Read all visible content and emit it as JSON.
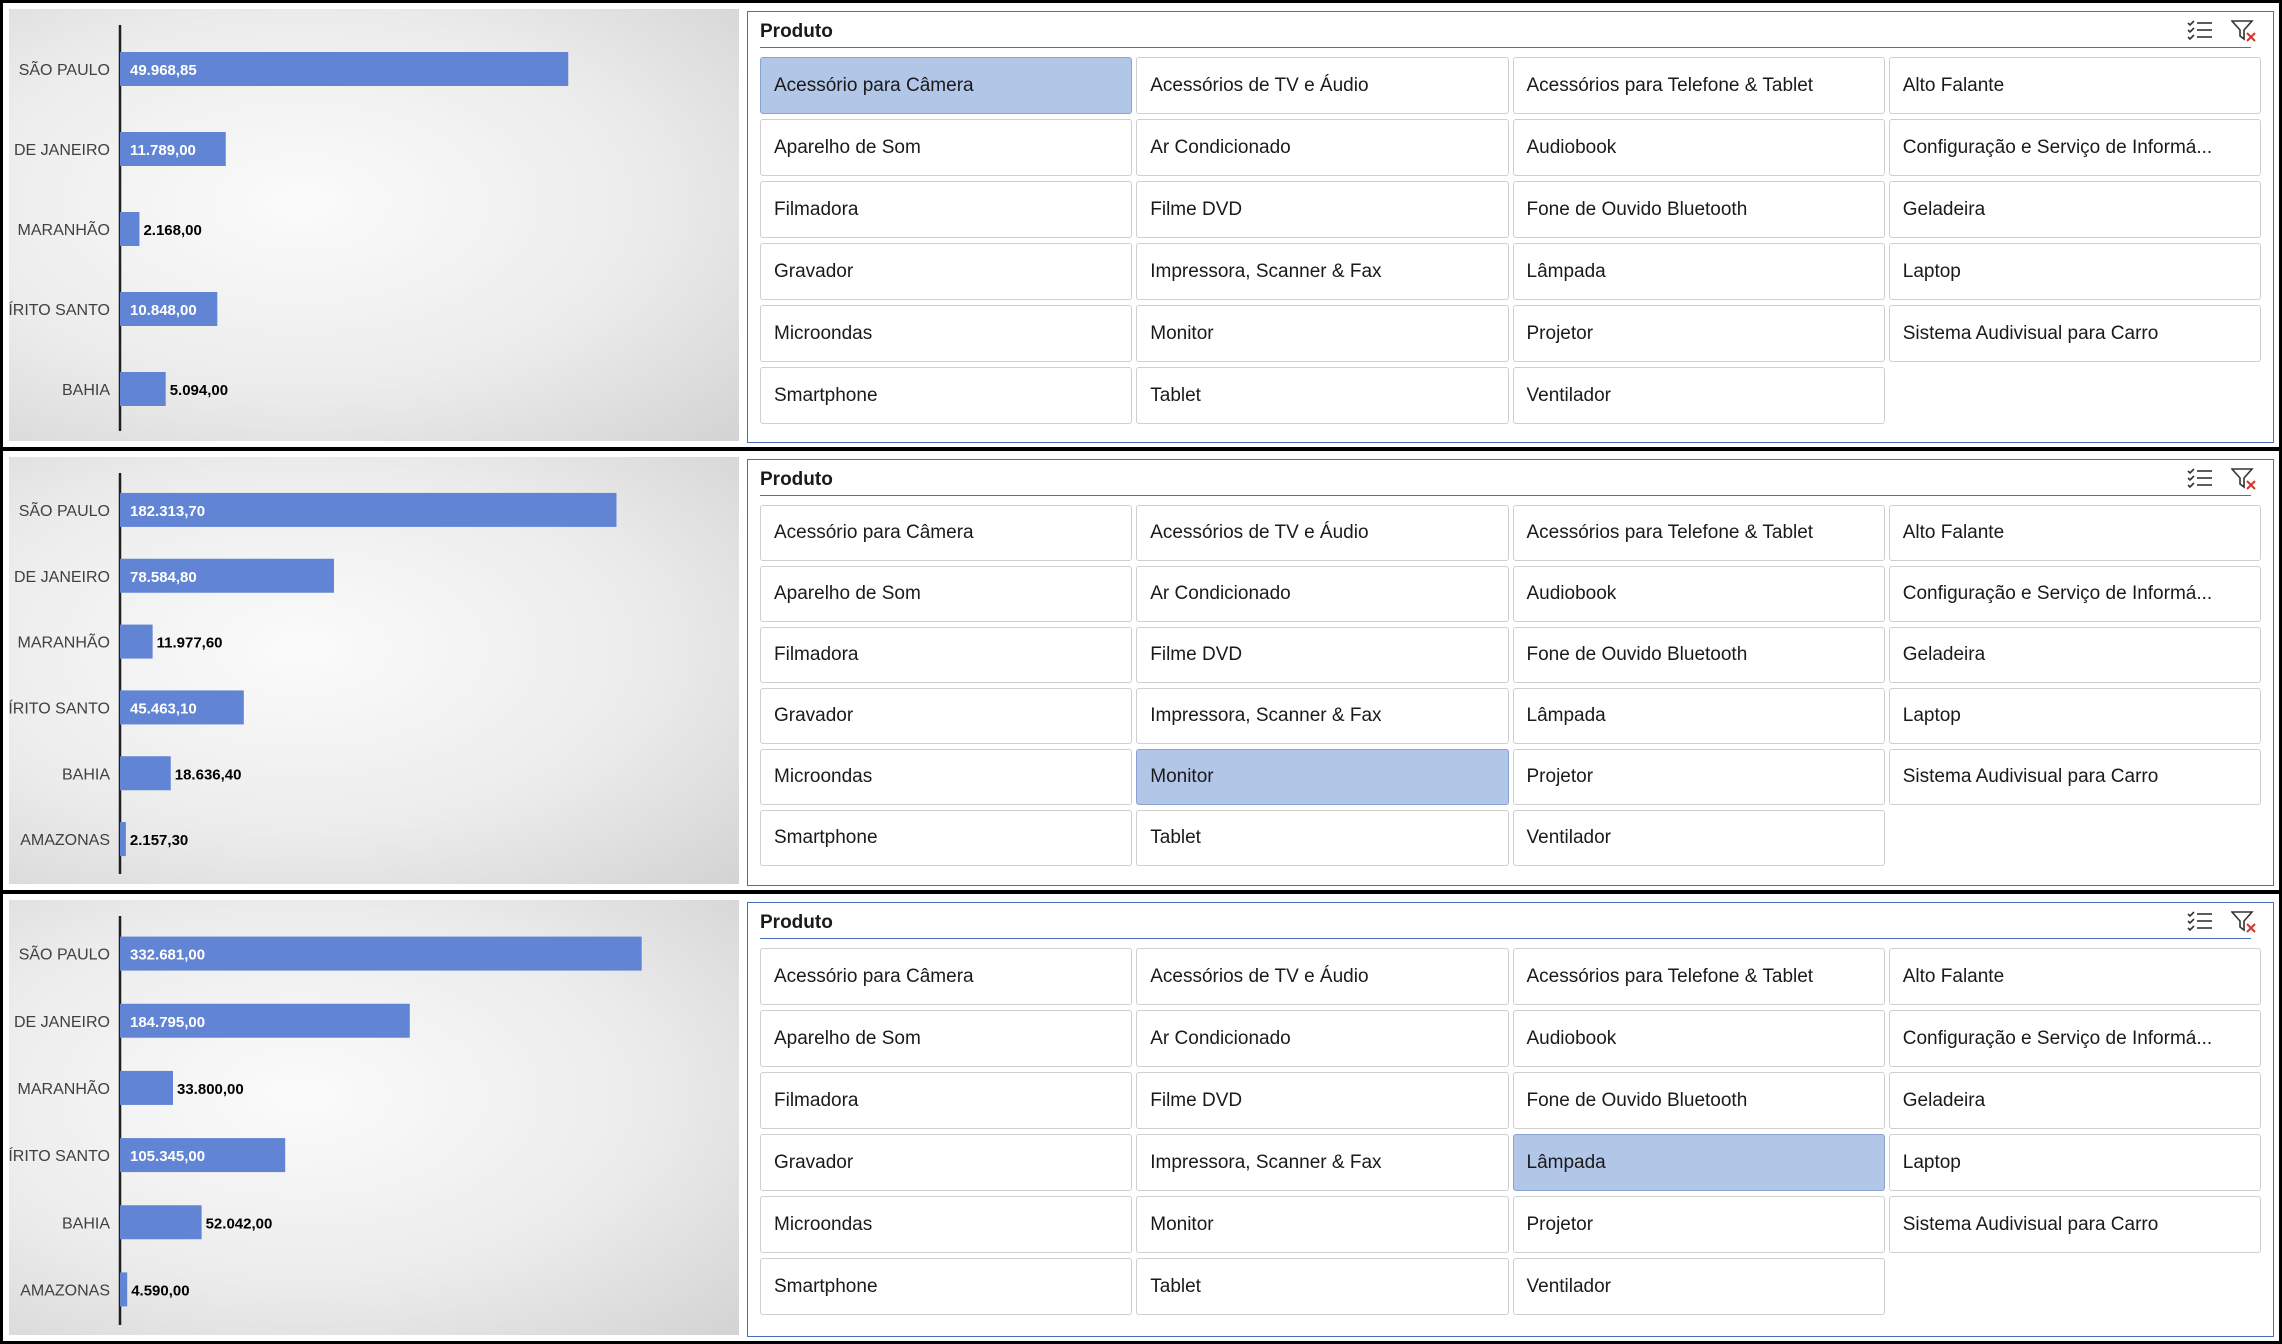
{
  "slicer_title": "Produto",
  "icons": {
    "multi_select": "multi-select-icon",
    "clear_filter": "clear-filter-icon"
  },
  "colors": {
    "bar": "#6185d4",
    "selected_item": "#b2c6e8",
    "slicer_border": "#4a6dbb"
  },
  "products": [
    "Acessório para Câmera",
    "Acessórios de TV e Áudio",
    "Acessórios para Telefone & Tablet",
    "Alto Falante",
    "Aparelho de Som",
    "Ar Condicionado",
    "Audiobook",
    "Configuração e Serviço de Informá...",
    "Filmadora",
    "Filme DVD",
    "Fone de Ouvido Bluetooth",
    "Geladeira",
    "Gravador",
    "Impressora, Scanner & Fax",
    "Lâmpada",
    "Laptop",
    "Microondas",
    "Monitor",
    "Projetor",
    "Sistema Audivisual para Carro",
    "Smartphone",
    "Tablet",
    "Ventilador"
  ],
  "panels": [
    {
      "selected_product": "Acessório para Câmera"
    },
    {
      "selected_product": "Monitor"
    },
    {
      "selected_product": "Lâmpada"
    }
  ],
  "chart_data": [
    {
      "type": "bar",
      "orientation": "horizontal",
      "categories": [
        "SÃO PAULO",
        "RIO DE JANEIRO",
        "MARANHÃO",
        "ESPÍRITO SANTO",
        "BAHIA"
      ],
      "values": [
        49968.85,
        11789.0,
        2168.0,
        10848.0,
        5094.0
      ],
      "value_labels": [
        "49.968,85",
        "11.789,00",
        "2.168,00",
        "10.848,00",
        "5.094,00"
      ],
      "xlim": [
        0,
        68000
      ]
    },
    {
      "type": "bar",
      "orientation": "horizontal",
      "categories": [
        "SÃO PAULO",
        "RIO DE JANEIRO",
        "MARANHÃO",
        "ESPÍRITO SANTO",
        "BAHIA",
        "AMAZONAS"
      ],
      "values": [
        182313.7,
        78584.8,
        11977.6,
        45463.1,
        18636.4,
        2157.3
      ],
      "value_labels": [
        "182.313,70",
        "78.584,80",
        "11.977,60",
        "45.463,10",
        "18.636,40",
        "2.157,30"
      ],
      "xlim": [
        0,
        224000
      ]
    },
    {
      "type": "bar",
      "orientation": "horizontal",
      "categories": [
        "SÃO PAULO",
        "RIO DE JANEIRO",
        "MARANHÃO",
        "ESPÍRITO SANTO",
        "BAHIA",
        "AMAZONAS"
      ],
      "values": [
        332681.0,
        184795.0,
        33800.0,
        105345.0,
        52042.0,
        4590.0
      ],
      "value_labels": [
        "332.681,00",
        "184.795,00",
        "33.800,00",
        "105.345,00",
        "52.042,00",
        "4.590,00"
      ],
      "xlim": [
        0,
        389000
      ]
    }
  ]
}
